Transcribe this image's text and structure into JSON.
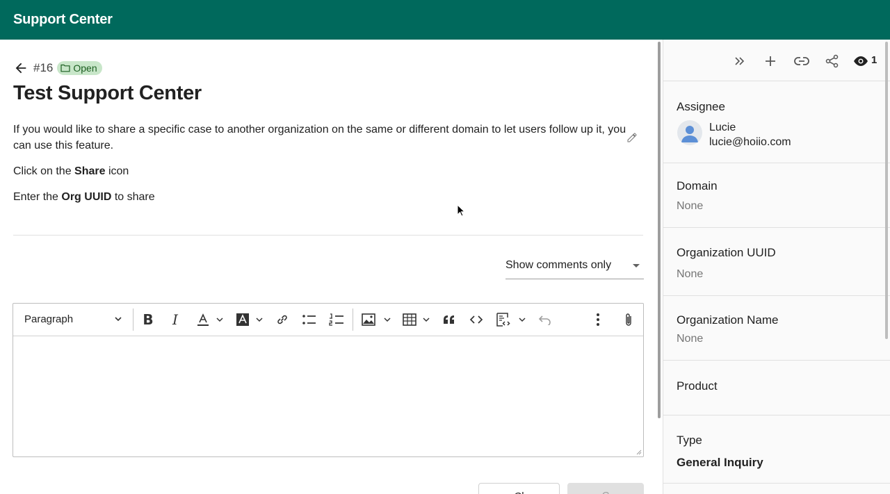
{
  "app": {
    "title": "Support Center"
  },
  "case": {
    "number": "#16",
    "status": "Open",
    "title": "Test Support Center",
    "description": {
      "p1": "If you would like to share a specific case to another organization on the same or different domain to let users follow up it, you can use this feature.",
      "p2_prefix": "Click on the ",
      "p2_bold": "Share",
      "p2_suffix": " icon",
      "p3_prefix": "Enter the ",
      "p3_bold": "Org UUID",
      "p3_suffix": " to share"
    }
  },
  "comments_filter": {
    "selected": "Show comments only"
  },
  "editor": {
    "block_format": "Paragraph",
    "toolbar_icons": [
      "bold-icon",
      "italic-icon",
      "font-color-icon",
      "highlight-icon",
      "link-icon",
      "bulleted-list-icon",
      "numbered-list-icon",
      "image-icon",
      "table-icon",
      "quote-icon",
      "code-icon",
      "code-block-icon",
      "undo-icon",
      "more-icon",
      "attachment-icon"
    ]
  },
  "actions": {
    "cancel_label": "Cl",
    "comment_label": "C"
  },
  "sidebar": {
    "watch_count": "1",
    "assignee": {
      "label": "Assignee",
      "name": "Lucie",
      "email": "lucie@hoiio.com"
    },
    "domain": {
      "label": "Domain",
      "value": "None"
    },
    "org_uuid": {
      "label": "Organization UUID",
      "value": "None"
    },
    "org_name": {
      "label": "Organization Name",
      "value": "None"
    },
    "product": {
      "label": "Product",
      "value": ""
    },
    "type": {
      "label": "Type",
      "value": "General Inquiry"
    }
  }
}
